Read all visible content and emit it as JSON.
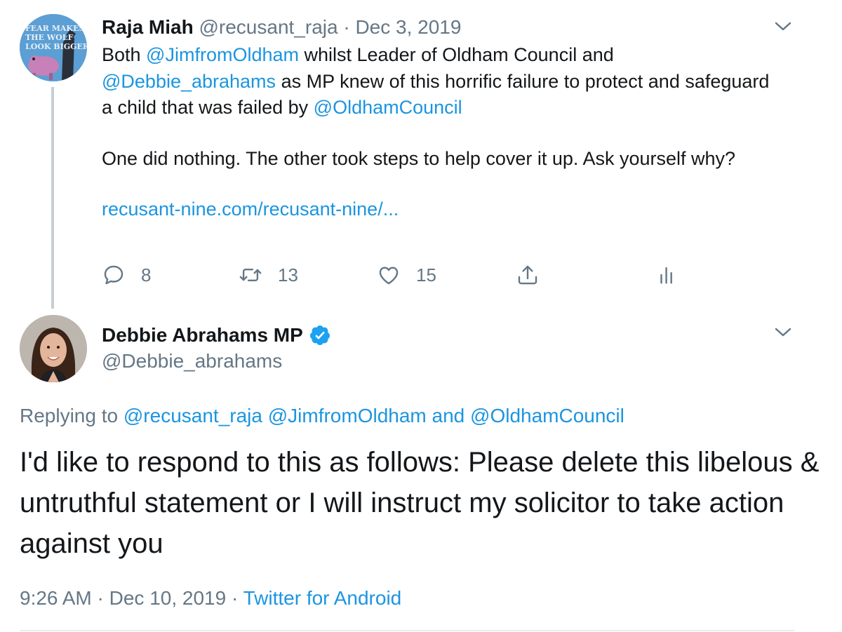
{
  "tweet1": {
    "author_name": "Raja Miah",
    "author_handle": "@recusant_raja",
    "separator": "·",
    "date": "Dec 3, 2019",
    "avatar_text": [
      "FEAR MAKES",
      "THE WOLF",
      "LOOK BIGGER"
    ],
    "body": {
      "p1_t1": "Both ",
      "p1_m1": "@JimfromOldham",
      "p1_t2": " whilst Leader of Oldham Council and",
      "p1_m2": "@Debbie_abrahams",
      "p1_t3": " as MP knew of this horrific failure to protect and safeguard a child that was failed by ",
      "p1_m3": "@OldhamCouncil",
      "p2": "One did nothing. The other took steps to help cover it up. Ask yourself why?",
      "link": "recusant-nine.com/recusant-nine/..."
    },
    "actions": {
      "reply_count": "8",
      "retweet_count": "13",
      "like_count": "15"
    }
  },
  "tweet2": {
    "author_name": "Debbie Abrahams MP",
    "author_handle": "@Debbie_abrahams",
    "replying_prefix": "Replying to ",
    "replying_user1": "@recusant_raja",
    "replying_user2": "@JimfromOldham",
    "replying_and": " and ",
    "replying_user3": "@OldhamCouncil",
    "text": "I'd like to respond to this as follows: Please delete this libelous & untruthful statement or I will instruct my solicitor to take action against you",
    "time": "9:26 AM",
    "separator": "·",
    "date": "Dec 10, 2019",
    "source": "Twitter for Android"
  },
  "colors": {
    "link": "#1b95e0",
    "muted": "#657786",
    "text": "#14171a",
    "verified": "#1da1f2"
  },
  "icons": [
    "reply-icon",
    "retweet-icon",
    "like-icon",
    "share-icon",
    "analytics-icon",
    "chevron-down-icon",
    "verified-badge-icon"
  ]
}
